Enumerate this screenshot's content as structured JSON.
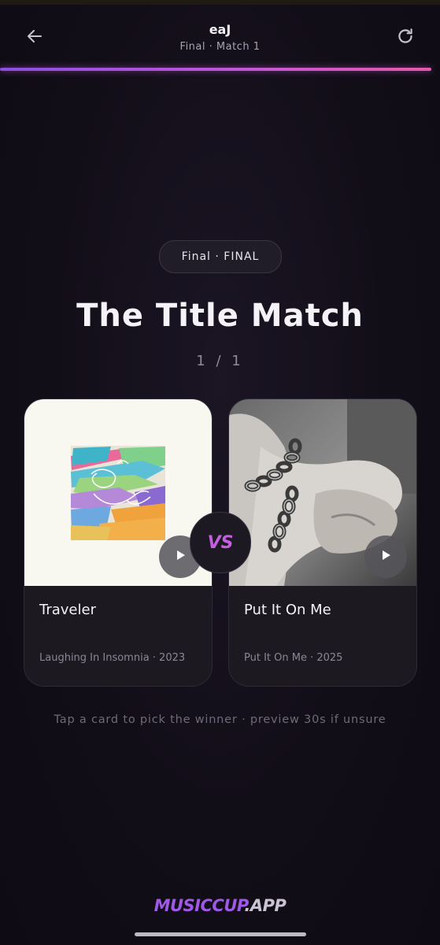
{
  "header": {
    "title": "eaJ",
    "subtitle": "Final · Match 1",
    "back_icon": "arrow-left-icon",
    "refresh_icon": "refresh-icon"
  },
  "progress": {
    "fraction": 1.0
  },
  "round": {
    "label": "Final · FINAL"
  },
  "headline": "The Title Match",
  "counter": "1 / 1",
  "cards": [
    {
      "title": "Traveler",
      "meta": "Laughing In Insomnia · 2023",
      "play_icon": "play-icon"
    },
    {
      "title": "Put It On Me",
      "meta": "Put It On Me · 2025",
      "play_icon": "play-icon"
    }
  ],
  "vs_label": "VS",
  "hint": "Tap a card to pick the winner · preview 30s if unsure",
  "brand": {
    "part1": "MUSICCUP",
    "part2": ".APP"
  },
  "colors": {
    "accent": "#c55fe0",
    "gradient_start": "#8a4fe0",
    "gradient_end": "#e55aa8",
    "background": "#120e18"
  }
}
